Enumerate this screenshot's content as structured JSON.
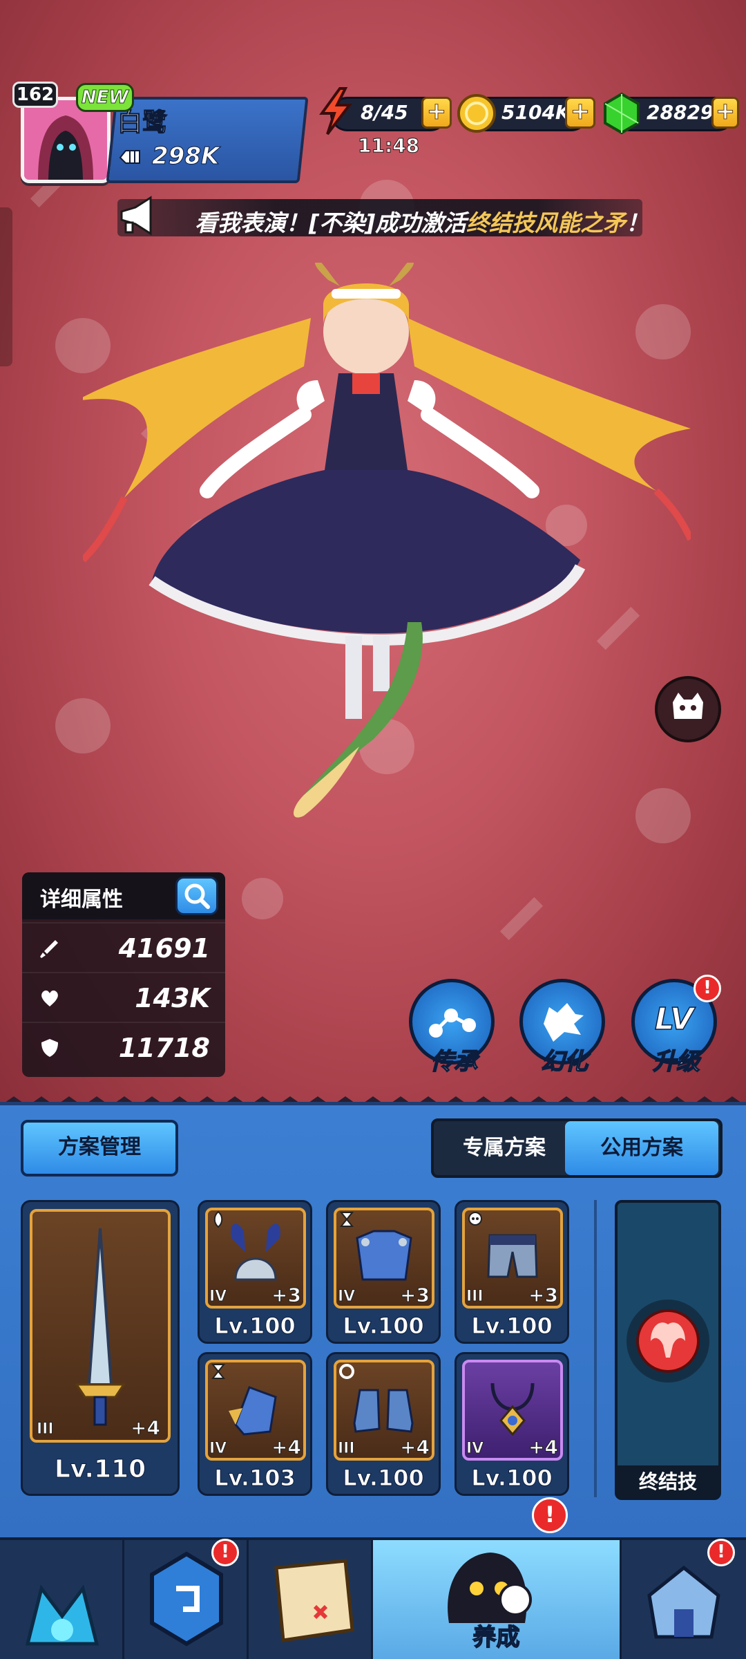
{
  "player": {
    "level": "162",
    "new_badge": "NEW",
    "name": "白鹭",
    "power": "298K"
  },
  "resources": {
    "energy": "8/45",
    "energy_timer": "11:48",
    "gold": "5104K",
    "gems": "28829"
  },
  "announcement": {
    "prefix": "看我表演！[不染]成功激活",
    "highlight": "终结技风能之矛",
    "suffix": "！"
  },
  "stats": {
    "title": "详细属性",
    "attack": "41691",
    "hp": "143K",
    "defense": "11718"
  },
  "actions": {
    "inherit": "传承",
    "transform": "幻化",
    "upgrade": "升级",
    "upgrade_icon_text": "LV"
  },
  "plans": {
    "manage": "方案管理",
    "exclusive": "专属方案",
    "public": "公用方案"
  },
  "equipment": {
    "weapon": {
      "tier": "III",
      "plus": "+4",
      "level": "Lv.110"
    },
    "slots": [
      {
        "tier": "IV",
        "plus": "+3",
        "level": "Lv.100"
      },
      {
        "tier": "IV",
        "plus": "+3",
        "level": "Lv.100"
      },
      {
        "tier": "III",
        "plus": "+3",
        "level": "Lv.100"
      },
      {
        "tier": "IV",
        "plus": "+4",
        "level": "Lv.103"
      },
      {
        "tier": "III",
        "plus": "+4",
        "level": "Lv.100"
      },
      {
        "tier": "IV",
        "plus": "+4",
        "level": "Lv.100"
      }
    ],
    "finisher_label": "终结技"
  },
  "nav": {
    "cultivate": "养成"
  },
  "alerts": {
    "mark": "!"
  },
  "colors": {
    "background": "#c25560",
    "panel_blue": "#3c7fd2",
    "gold_border": "#e5a33c",
    "purple_border": "#c98af2",
    "highlight_text": "#f4c757"
  }
}
